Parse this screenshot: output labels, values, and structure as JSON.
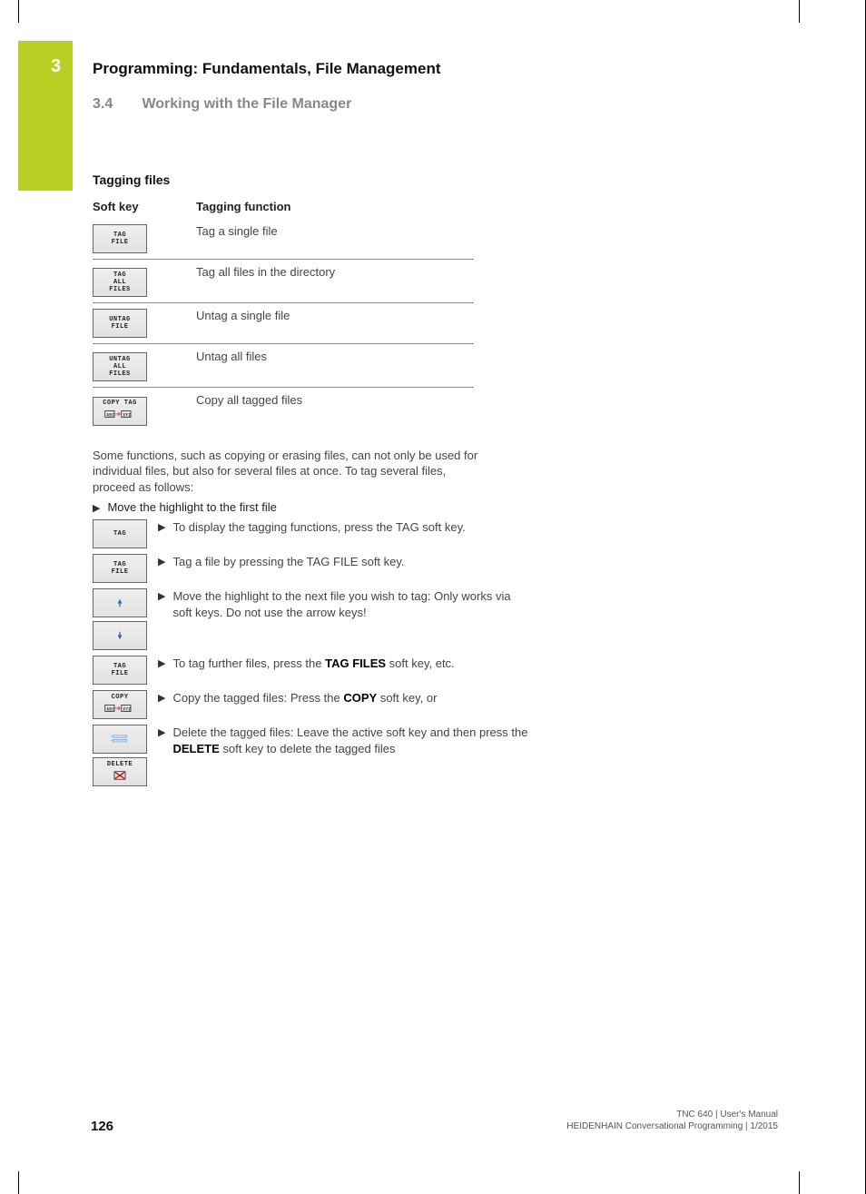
{
  "chapter": {
    "number": "3",
    "title": "Programming: Fundamentals, File Management"
  },
  "section": {
    "number": "3.4",
    "title": "Working with the File Manager"
  },
  "subhead": "Tagging files",
  "table": {
    "head_softkey": "Soft key",
    "head_function": "Tagging function",
    "rows": [
      {
        "key_lines": [
          "TAG",
          "FILE"
        ],
        "desc": "Tag a single file"
      },
      {
        "key_lines": [
          "TAG",
          "ALL",
          "FILES"
        ],
        "desc": "Tag all files in the directory"
      },
      {
        "key_lines": [
          "UNTAG",
          "FILE"
        ],
        "desc": "Untag a single file"
      },
      {
        "key_lines": [
          "UNTAG",
          "ALL",
          "FILES"
        ],
        "desc": "Untag all files"
      },
      {
        "key_top": "COPY TAG",
        "has_copy_icon": true,
        "desc": "Copy all tagged files"
      }
    ]
  },
  "intro_para": "Some functions, such as copying or erasing files, can not only be used for individual files, but also for several files at once. To tag several files, proceed as follows:",
  "first_bullet": "Move the highlight to the first file",
  "steps": [
    {
      "keys": [
        {
          "lines": [
            "TAG"
          ]
        }
      ],
      "lines": [
        "To display the tagging functions, press the TAG soft key."
      ]
    },
    {
      "keys": [
        {
          "lines": [
            "TAG",
            "FILE"
          ]
        }
      ],
      "lines": [
        "Tag a file by pressing the TAG FILE soft key."
      ]
    },
    {
      "keys": [
        {
          "arrow_up": true
        },
        {
          "arrow_down": true
        }
      ],
      "lines": [
        "Move the highlight to the next file you wish to tag: Only works via soft keys. Do not use the arrow keys!"
      ]
    },
    {
      "keys": [
        {
          "lines": [
            "TAG",
            "FILE"
          ]
        }
      ],
      "lines_html": "To tag further files, press the <b class='kw'>TAG FILES</b> soft key, etc."
    },
    {
      "keys": [
        {
          "top": "COPY",
          "copy_icon": true
        }
      ],
      "lines_html": "Copy the tagged files: Press the <b class='kw'>COPY</b> soft key, or"
    },
    {
      "keys": [
        {
          "blank_rows": true
        },
        {
          "top": "DELETE",
          "delete_icon": true
        }
      ],
      "lines_html": "Delete the tagged files: Leave the active soft key and then press the <b class='kw'>DELETE</b> soft key to delete the tagged files"
    }
  ],
  "footer": {
    "line1": "TNC 640 | User's Manual",
    "line2": "HEIDENHAIN Conversational Programming | 1/2015"
  },
  "page_number": "126"
}
